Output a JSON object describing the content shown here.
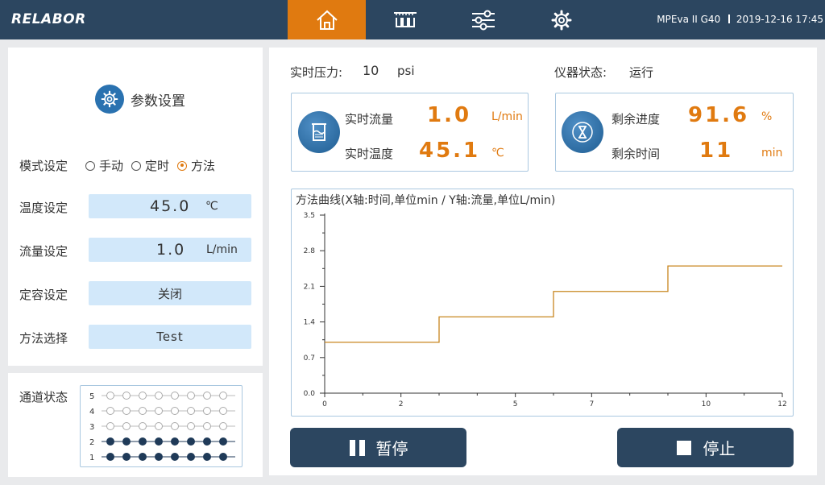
{
  "header": {
    "logo": "RELABOR",
    "device": "MPEva II G40",
    "datetime": "2019-12-16  17:45"
  },
  "nav": [
    {
      "icon": "home-icon",
      "active": true
    },
    {
      "icon": "manifold-icon",
      "active": false
    },
    {
      "icon": "sliders-icon",
      "active": false
    },
    {
      "icon": "gear-icon",
      "active": false
    }
  ],
  "settings": {
    "title": "参数设置",
    "mode_label": "模式设定",
    "mode_options": [
      "手动",
      "定时",
      "方法"
    ],
    "mode_selected": "方法",
    "temp_label": "温度设定",
    "temp_value": "45.0",
    "temp_unit": "℃",
    "flow_label": "流量设定",
    "flow_value": "1.0",
    "flow_unit": "L/min",
    "volume_label": "定容设定",
    "volume_value": "关闭",
    "method_label": "方法选择",
    "method_value": "Test"
  },
  "channels": {
    "label": "通道状态",
    "rows": [
      {
        "num": "5",
        "active": false
      },
      {
        "num": "4",
        "active": false
      },
      {
        "num": "3",
        "active": false
      },
      {
        "num": "2",
        "active": true
      },
      {
        "num": "1",
        "active": true
      }
    ],
    "per_row": 8
  },
  "status": {
    "pressure_label": "实时压力:",
    "pressure_value": "10",
    "pressure_unit": "psi",
    "instrument_label": "仪器状态:",
    "instrument_value": "运行"
  },
  "live": {
    "flow_label": "实时流量",
    "flow_value": "1.0",
    "flow_unit": "L/min",
    "temp_label": "实时温度",
    "temp_value": "45.1",
    "temp_unit": "℃"
  },
  "progress": {
    "progress_label": "剩余进度",
    "progress_value": "91.6",
    "progress_unit": "%",
    "time_label": "剩余时间",
    "time_value": "11",
    "time_unit": "min"
  },
  "chart_data": {
    "type": "line",
    "title": "方法曲线(X轴:时间,单位min / Y轴:流量,单位L/min)",
    "xlim": [
      0,
      12
    ],
    "ylim": [
      0,
      3.5
    ],
    "x_ticks": [
      0,
      2,
      5,
      7,
      10,
      12
    ],
    "y_ticks": [
      0.0,
      0.7,
      1.4,
      2.1,
      2.8,
      3.5
    ],
    "x_tick_labels": [
      "0",
      "2",
      "5",
      "7",
      "10",
      "12"
    ],
    "y_tick_labels": [
      "0.0",
      "0.7",
      "1.4",
      "2.1",
      "2.8",
      "3.5"
    ],
    "series": [
      {
        "x": [
          0,
          3,
          3,
          6,
          6,
          9,
          9,
          12
        ],
        "y": [
          1.0,
          1.0,
          1.5,
          1.5,
          2.0,
          2.0,
          2.5,
          2.5
        ]
      }
    ],
    "line_color": "#c8861f",
    "grid": false
  },
  "buttons": {
    "pause": "暂停",
    "stop": "停止"
  }
}
